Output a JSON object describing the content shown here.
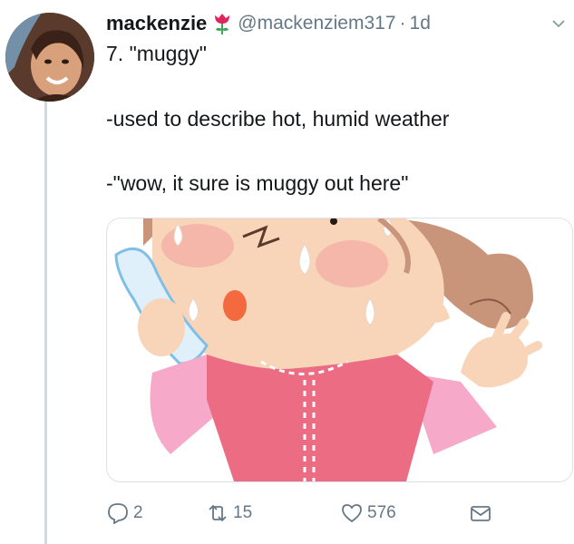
{
  "tweet": {
    "display_name": "mackenzie",
    "handle": "@mackenziem317",
    "separator": "·",
    "time": "1d",
    "lines": [
      "7. \"muggy\"",
      "-used to describe hot, humid weather",
      "-\"wow, it sure is muggy out here\""
    ]
  },
  "actions": {
    "replies": "2",
    "retweets": "15",
    "likes": "576"
  },
  "icons": {
    "name_emoji": "rose-icon",
    "menu": "chevron-down-icon",
    "reply": "reply-icon",
    "retweet": "retweet-icon",
    "like": "heart-icon",
    "dm": "envelope-icon"
  },
  "colors": {
    "secondary_text": "#657786",
    "thread_line": "#cfd9de",
    "rose": "#e0245e"
  }
}
